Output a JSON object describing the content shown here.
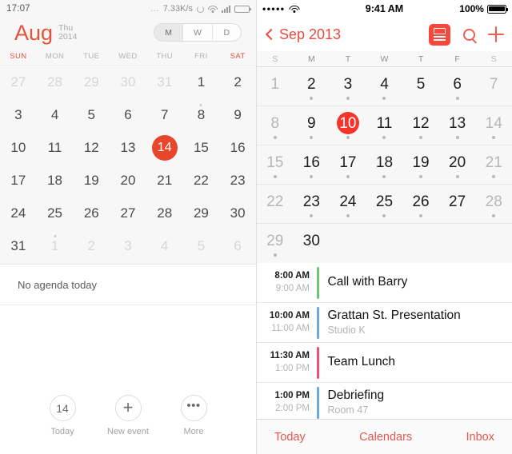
{
  "left": {
    "status": {
      "clock": "17:07",
      "dots": "...",
      "network_speed": "7.33K/s",
      "sync_icon": "sync-circle-icon",
      "wifi_icon": "wifi-icon",
      "signal_icon": "signal-bars-icon",
      "battery_icon": "battery-icon"
    },
    "header": {
      "month": "Aug",
      "weekday": "Thu",
      "year": "2014",
      "segments": [
        {
          "label": "M",
          "selected": true
        },
        {
          "label": "W",
          "selected": false
        },
        {
          "label": "D",
          "selected": false
        }
      ]
    },
    "dow": [
      "SUN",
      "MON",
      "TUE",
      "WED",
      "THU",
      "FRI",
      "SAT"
    ],
    "weekend_indices": [
      0,
      6
    ],
    "days": [
      {
        "n": "27",
        "dim": true
      },
      {
        "n": "28",
        "dim": true
      },
      {
        "n": "29",
        "dim": true
      },
      {
        "n": "30",
        "dim": true
      },
      {
        "n": "31",
        "dim": true
      },
      {
        "n": "1"
      },
      {
        "n": "2"
      },
      {
        "n": "3"
      },
      {
        "n": "4"
      },
      {
        "n": "5"
      },
      {
        "n": "6"
      },
      {
        "n": "7"
      },
      {
        "n": "8",
        "dot": true
      },
      {
        "n": "9"
      },
      {
        "n": "10"
      },
      {
        "n": "11"
      },
      {
        "n": "12"
      },
      {
        "n": "13"
      },
      {
        "n": "14",
        "selected": true
      },
      {
        "n": "15"
      },
      {
        "n": "16"
      },
      {
        "n": "17"
      },
      {
        "n": "18"
      },
      {
        "n": "19"
      },
      {
        "n": "20"
      },
      {
        "n": "21"
      },
      {
        "n": "22"
      },
      {
        "n": "23"
      },
      {
        "n": "24"
      },
      {
        "n": "25"
      },
      {
        "n": "26"
      },
      {
        "n": "27"
      },
      {
        "n": "28"
      },
      {
        "n": "29"
      },
      {
        "n": "30"
      },
      {
        "n": "31"
      },
      {
        "n": "1",
        "dim": true,
        "dot": true
      },
      {
        "n": "2",
        "dim": true
      },
      {
        "n": "3",
        "dim": true
      },
      {
        "n": "4",
        "dim": true
      },
      {
        "n": "5",
        "dim": true
      },
      {
        "n": "6",
        "dim": true
      }
    ],
    "agenda_empty_text": "No agenda today",
    "tabs": [
      {
        "glyph": "14",
        "label": "Today",
        "icon": "today-date-icon"
      },
      {
        "glyph": "+",
        "label": "New event",
        "icon": "plus-icon"
      },
      {
        "glyph": "•••",
        "label": "More",
        "icon": "more-dots-icon"
      }
    ],
    "accent_color": "#e8462b"
  },
  "right": {
    "status": {
      "signal": "•••••",
      "wifi_icon": "wifi-icon",
      "time": "9:41 AM",
      "battery_percent": "100%",
      "battery_icon": "battery-full-icon"
    },
    "navbar": {
      "back_icon": "chevron-left-icon",
      "title": "Sep 2013",
      "list_view_icon": "day-view-icon",
      "search_icon": "search-icon",
      "add_icon": "plus-icon"
    },
    "dow": [
      "S",
      "M",
      "T",
      "W",
      "T",
      "F",
      "S"
    ],
    "weekend_indices": [
      0,
      6
    ],
    "weeks": [
      [
        {
          "n": "1",
          "out": true,
          "dot": false
        },
        {
          "n": "2",
          "dot": true
        },
        {
          "n": "3",
          "dot": true
        },
        {
          "n": "4",
          "dot": true
        },
        {
          "n": "5",
          "dot": false
        },
        {
          "n": "6",
          "dot": true
        },
        {
          "n": "7",
          "out": true,
          "dot": false
        }
      ],
      [
        {
          "n": "8",
          "out": true,
          "dot": true
        },
        {
          "n": "9",
          "dot": true
        },
        {
          "n": "10",
          "today": true,
          "dot": true
        },
        {
          "n": "11",
          "dot": true
        },
        {
          "n": "12",
          "dot": true
        },
        {
          "n": "13",
          "dot": true
        },
        {
          "n": "14",
          "out": true,
          "dot": true
        }
      ],
      [
        {
          "n": "15",
          "out": true,
          "dot": true
        },
        {
          "n": "16",
          "dot": true
        },
        {
          "n": "17",
          "dot": true
        },
        {
          "n": "18",
          "dot": true
        },
        {
          "n": "19",
          "dot": true
        },
        {
          "n": "20",
          "dot": true
        },
        {
          "n": "21",
          "out": true,
          "dot": true
        }
      ],
      [
        {
          "n": "22",
          "out": true,
          "dot": false
        },
        {
          "n": "23",
          "dot": true
        },
        {
          "n": "24",
          "dot": true
        },
        {
          "n": "25",
          "dot": true
        },
        {
          "n": "26",
          "dot": true
        },
        {
          "n": "27",
          "dot": false
        },
        {
          "n": "28",
          "out": true,
          "dot": true
        }
      ],
      [
        {
          "n": "29",
          "out": true,
          "dot": true
        },
        {
          "n": "30",
          "dot": false
        },
        {
          "n": "",
          "empty": true
        },
        {
          "n": "",
          "empty": true
        },
        {
          "n": "",
          "empty": true
        },
        {
          "n": "",
          "empty": true
        },
        {
          "n": "",
          "empty": true
        }
      ]
    ],
    "events": [
      {
        "start": "8:00 AM",
        "end": "9:00 AM",
        "title": "Call with Barry",
        "location": "",
        "color": "#6dc771"
      },
      {
        "start": "10:00 AM",
        "end": "11:00 AM",
        "title": "Grattan St. Presentation",
        "location": "Studio K",
        "color": "#6aa9dd"
      },
      {
        "start": "11:30 AM",
        "end": "1:00 PM",
        "title": "Team Lunch",
        "location": "",
        "color": "#ef4f73"
      },
      {
        "start": "1:00 PM",
        "end": "2:00 PM",
        "title": "Debriefing",
        "location": "Room 47",
        "color": "#6aa9dd"
      }
    ],
    "toolbar": [
      {
        "label": "Today"
      },
      {
        "label": "Calendars"
      },
      {
        "label": "Inbox"
      }
    ],
    "accent_color": "#ec4a3e",
    "today_color": "#f7342b"
  }
}
